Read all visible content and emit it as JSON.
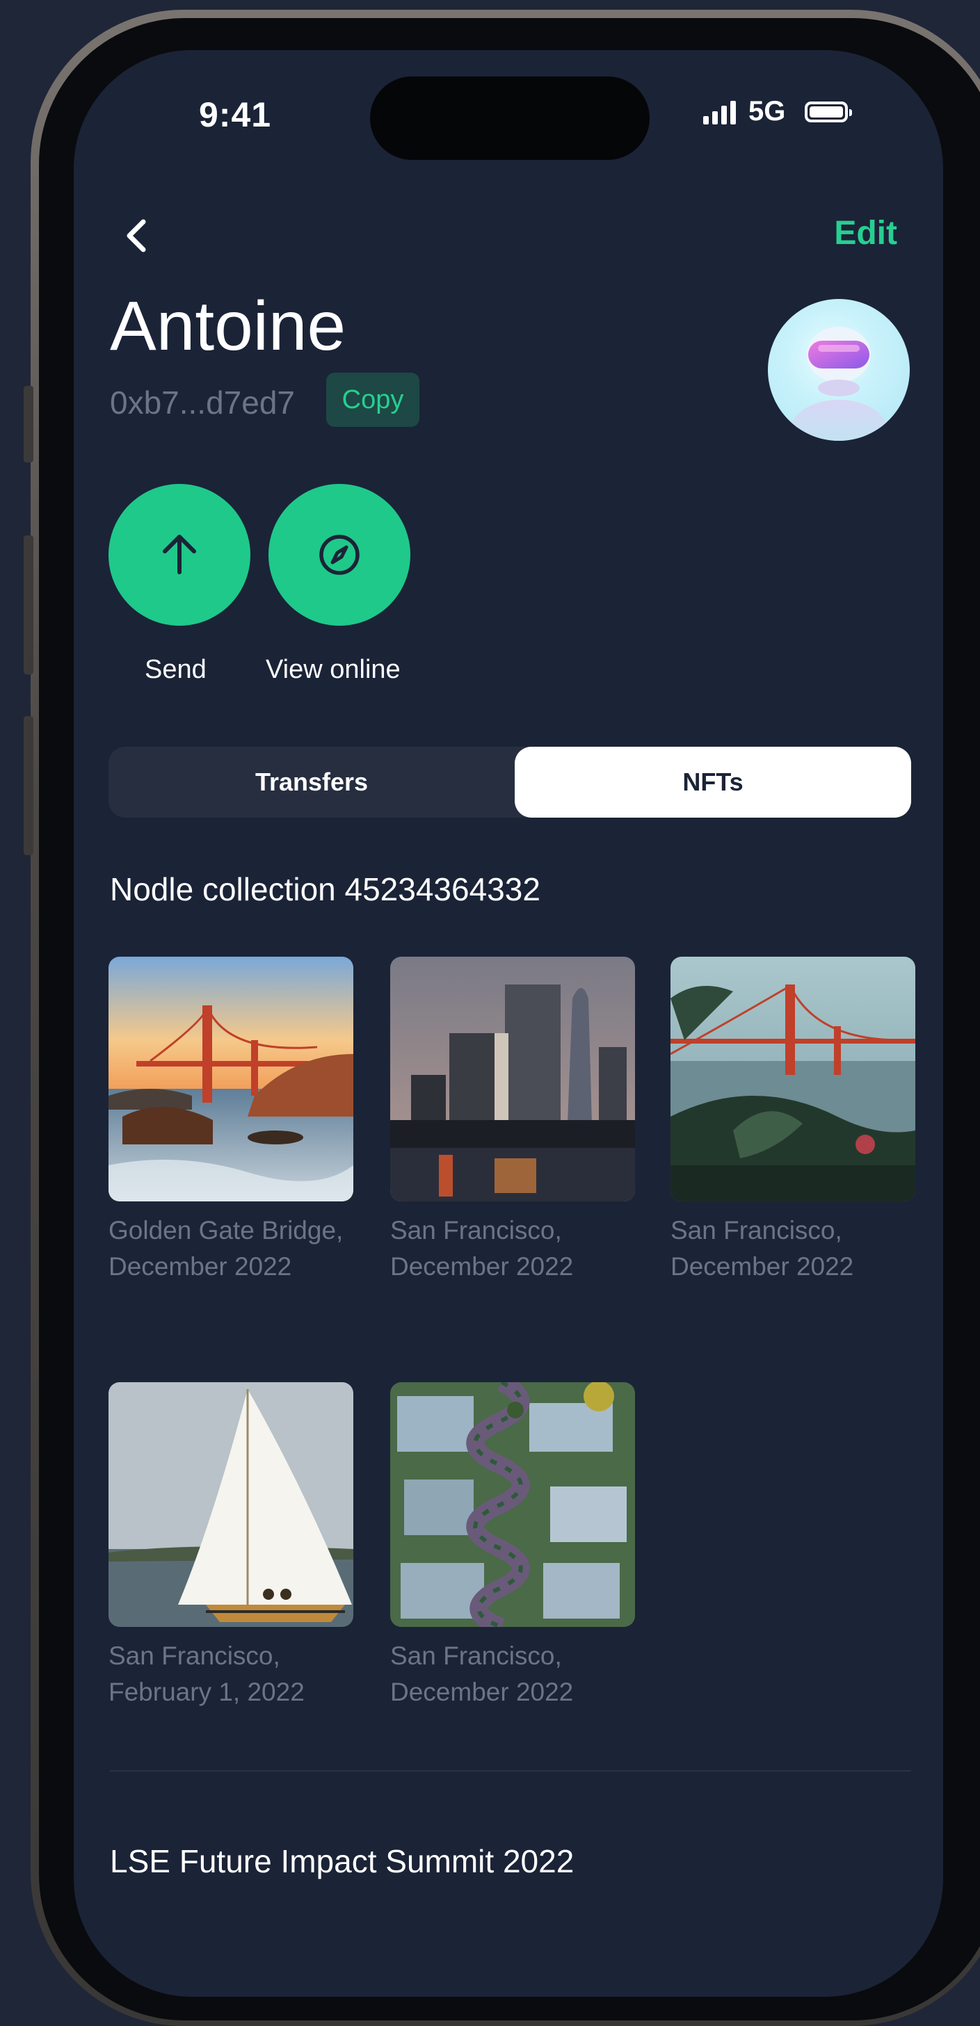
{
  "status_bar": {
    "time": "9:41",
    "network": "5G"
  },
  "header": {
    "edit_label": "Edit"
  },
  "profile": {
    "name": "Antoine",
    "address": "0xb7...d7ed7",
    "copy_label": "Copy"
  },
  "actions": [
    {
      "label": "Send",
      "icon": "arrow-up-icon"
    },
    {
      "label": "View online",
      "icon": "compass-icon"
    }
  ],
  "tabs": [
    {
      "label": "Transfers",
      "active": false
    },
    {
      "label": "NFTs",
      "active": true
    }
  ],
  "collections": [
    {
      "title": "Nodle collection 45234364332",
      "items": [
        {
          "caption": "Golden Gate Bridge, December 2022",
          "image": "golden-gate-beach"
        },
        {
          "caption": "San Francisco, December 2022",
          "image": "city-skyline"
        },
        {
          "caption": "San Francisco, December 2022",
          "image": "golden-gate-plants"
        },
        {
          "caption": "San Francisco, February 1, 2022",
          "image": "sailboat"
        },
        {
          "caption": "San Francisco, December 2022",
          "image": "lombard-street-aerial"
        }
      ]
    },
    {
      "title": "LSE Future Impact Summit 2022",
      "items": []
    }
  ],
  "colors": {
    "background": "#1f2638",
    "screen": "#1b2337",
    "accent": "#27cf90",
    "action_button": "#1fc98a",
    "muted_text": "#6b7489"
  }
}
